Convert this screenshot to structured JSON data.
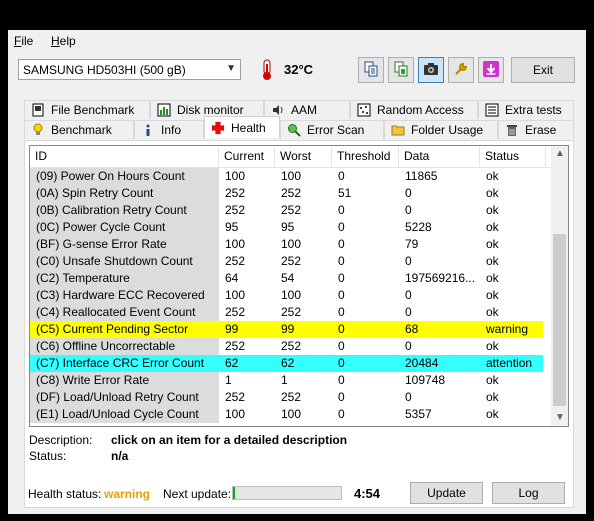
{
  "menu": {
    "file": "File",
    "file_accel": "F",
    "file_rest": "ile",
    "help": "Help",
    "help_accel": "H",
    "help_rest": "elp"
  },
  "toolbar": {
    "drive": "SAMSUNG HD503HI (500 gB)",
    "temperature": "32°C",
    "exit_label": "Exit",
    "buttons": [
      "copy-text-icon",
      "copy-report-icon",
      "screenshot-camera-icon",
      "options-wrench-icon",
      "save-download-icon"
    ],
    "accent_save": "#cc33cc"
  },
  "tabs": {
    "top": [
      "File Benchmark",
      "Disk monitor",
      "AAM",
      "Random Access",
      "Extra tests"
    ],
    "bottom": [
      "Benchmark",
      "Info",
      "Health",
      "Error Scan",
      "Folder Usage",
      "Erase"
    ],
    "selected": "Health"
  },
  "table": {
    "columns": [
      "ID",
      "Current",
      "Worst",
      "Threshold",
      "Data",
      "Status"
    ],
    "rows": [
      {
        "id": "(09) Power On Hours Count",
        "current": "100",
        "worst": "100",
        "threshold": "0",
        "data": "11865",
        "status": "ok",
        "highlight": ""
      },
      {
        "id": "(0A) Spin Retry Count",
        "current": "252",
        "worst": "252",
        "threshold": "51",
        "data": "0",
        "status": "ok",
        "highlight": ""
      },
      {
        "id": "(0B) Calibration Retry Count",
        "current": "252",
        "worst": "252",
        "threshold": "0",
        "data": "0",
        "status": "ok",
        "highlight": ""
      },
      {
        "id": "(0C) Power Cycle Count",
        "current": "95",
        "worst": "95",
        "threshold": "0",
        "data": "5228",
        "status": "ok",
        "highlight": ""
      },
      {
        "id": "(BF) G-sense Error Rate",
        "current": "100",
        "worst": "100",
        "threshold": "0",
        "data": "79",
        "status": "ok",
        "highlight": ""
      },
      {
        "id": "(C0) Unsafe Shutdown Count",
        "current": "252",
        "worst": "252",
        "threshold": "0",
        "data": "0",
        "status": "ok",
        "highlight": ""
      },
      {
        "id": "(C2) Temperature",
        "current": "64",
        "worst": "54",
        "threshold": "0",
        "data": "197569216...",
        "status": "ok",
        "highlight": ""
      },
      {
        "id": "(C3) Hardware ECC Recovered",
        "current": "100",
        "worst": "100",
        "threshold": "0",
        "data": "0",
        "status": "ok",
        "highlight": ""
      },
      {
        "id": "(C4) Reallocated Event Count",
        "current": "252",
        "worst": "252",
        "threshold": "0",
        "data": "0",
        "status": "ok",
        "highlight": ""
      },
      {
        "id": "(C5) Current Pending Sector",
        "current": "99",
        "worst": "99",
        "threshold": "0",
        "data": "68",
        "status": "warning",
        "highlight": "yellow"
      },
      {
        "id": "(C6) Offline Uncorrectable",
        "current": "252",
        "worst": "252",
        "threshold": "0",
        "data": "0",
        "status": "ok",
        "highlight": ""
      },
      {
        "id": "(C7) Interface CRC Error Count",
        "current": "62",
        "worst": "62",
        "threshold": "0",
        "data": "20484",
        "status": "attention",
        "highlight": "cyan"
      },
      {
        "id": "(C8) Write Error Rate",
        "current": "1",
        "worst": "1",
        "threshold": "0",
        "data": "109748",
        "status": "ok",
        "highlight": ""
      },
      {
        "id": "(DF) Load/Unload Retry Count",
        "current": "252",
        "worst": "252",
        "threshold": "0",
        "data": "0",
        "status": "ok",
        "highlight": ""
      },
      {
        "id": "(E1) Load/Unload Cycle Count",
        "current": "100",
        "worst": "100",
        "threshold": "0",
        "data": "5357",
        "status": "ok",
        "highlight": ""
      }
    ]
  },
  "description": {
    "desc_label": "Description:",
    "desc_value": "click on an item for a detailed description",
    "status_label": "Status:",
    "status_value": "n/a"
  },
  "footer": {
    "health_label": "Health status:",
    "health_value": "warning",
    "next_update_label": "Next update:",
    "update_progress": 0.02,
    "countdown": "4:54",
    "update_button": "Update",
    "log_button": "Log"
  }
}
